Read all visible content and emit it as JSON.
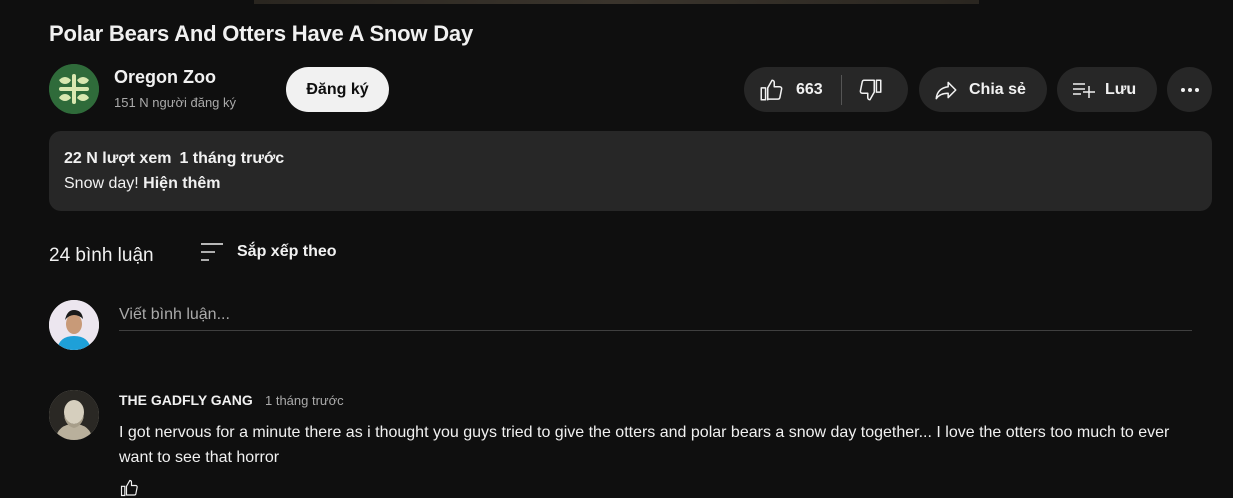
{
  "video": {
    "title": "Polar Bears And Otters Have A Snow Day"
  },
  "channel": {
    "name": "Oregon Zoo",
    "subscribers": "151 N người đăng ký",
    "subscribe_label": "Đăng ký",
    "avatar_icon": "oregon-zoo-logo",
    "avatar_color": "#2f6b3a"
  },
  "actions": {
    "like_count": "663",
    "share_label": "Chia sẻ",
    "save_label": "Lưu",
    "like_icon": "thumbs-up-icon",
    "dislike_icon": "thumbs-down-icon",
    "share_icon": "share-arrow-icon",
    "save_icon": "playlist-add-icon",
    "more_icon": "more-horizontal-icon"
  },
  "description": {
    "views": "22 N lượt xem",
    "date": "1 tháng trước",
    "text": "Snow day!",
    "show_more": "Hiện thêm"
  },
  "comments": {
    "count_label": "24 bình luận",
    "sort_label": "Sắp xếp theo",
    "input_placeholder": "Viết bình luận...",
    "items": [
      {
        "author": "THE GADFLY GANG",
        "time": "1 tháng trước",
        "text": "I got nervous for a minute there as i thought you guys tried to give the otters and polar bears a snow day together... I love the otters too much to ever want to see that horror"
      }
    ]
  },
  "colors": {
    "background": "#0f0f0f",
    "surface": "#272727",
    "text_primary": "#f1f1f1",
    "text_secondary": "#aaaaaa"
  }
}
